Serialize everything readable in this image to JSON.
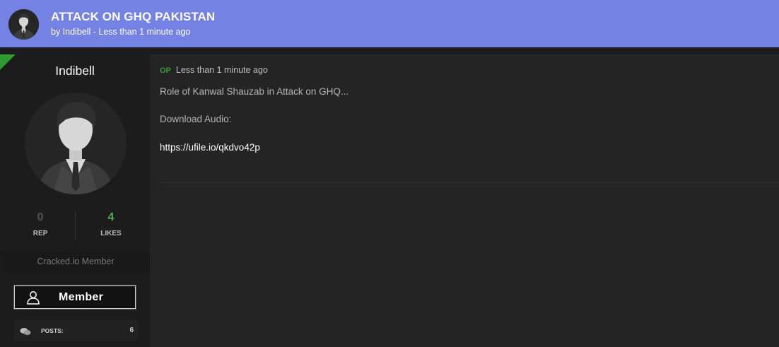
{
  "header": {
    "title": "ATTACK ON GHQ PAKISTAN",
    "byline": "by Indibell - Less than 1 minute ago",
    "avatar_icon": "user-suit-avatar"
  },
  "author": {
    "username": "Indibell",
    "avatar_icon": "user-suit-avatar",
    "rep_value": "0",
    "rep_label": "REP",
    "likes_value": "4",
    "likes_label": "LIKES",
    "member_title": "Cracked.io Member",
    "badge_label": "Member",
    "badge_icon": "user-outline-icon",
    "posts_icon": "chat-bubbles-icon",
    "posts_label": "POSTS:",
    "posts_value": "6"
  },
  "post": {
    "op_label": "OP",
    "time": "Less than 1 minute ago",
    "line1": "Role of Kanwal Shauzab in Attack on GHQ...",
    "line2": "Download Audio:",
    "link": "https://ufile.io/qkdvo42p"
  },
  "colors": {
    "header_bg": "#7382e3",
    "likes_green": "#4caf50",
    "op_green": "#3a9a3a",
    "corner_green": "#2f9a2f"
  }
}
